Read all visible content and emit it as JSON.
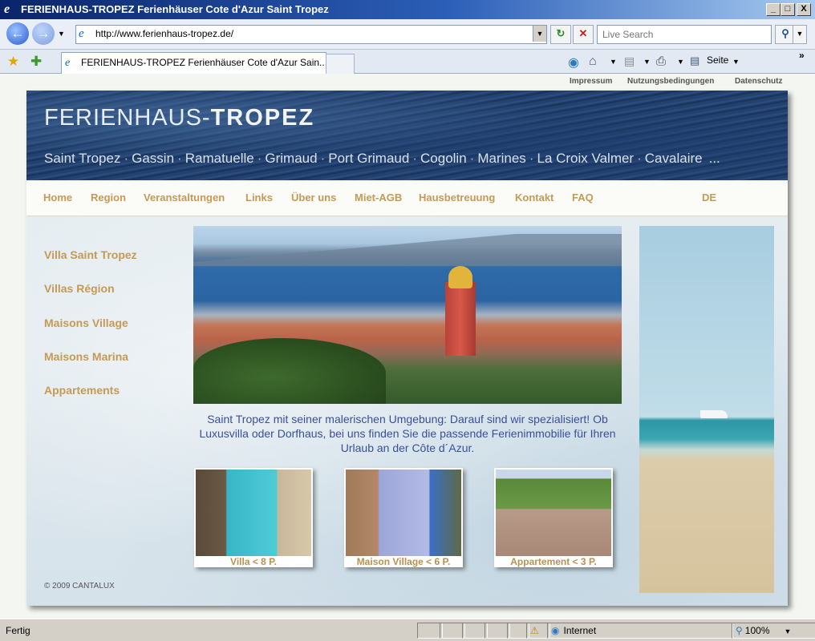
{
  "window": {
    "title": "FERIENHAUS-TROPEZ Ferienhäuser Cote d'Azur Saint Tropez",
    "minimize_label": "_",
    "maximize_label": "□",
    "close_label": "X"
  },
  "addressbar": {
    "url": "http://www.ferienhaus-tropez.de/",
    "search_placeholder": "Live Search"
  },
  "tabs": {
    "active_label": "FERIENHAUS-TROPEZ Ferienhäuser Cote d'Azur Sain..."
  },
  "commandbar": {
    "page_label": "Seite",
    "more_label": "»"
  },
  "site": {
    "toplinks": [
      "Impressum",
      "Nutzungsbedingungen",
      "Datenschutz"
    ],
    "brand_light": "FERIENHAUS-",
    "brand_bold": "TROPEZ",
    "places": [
      "Saint Tropez",
      "Gassin",
      "Ramatuelle",
      "Grimaud",
      "Port Grimaud",
      "Cogolin",
      "Marines",
      "La Croix Valmer",
      "Cavalaire",
      "..."
    ],
    "place_separator": "·",
    "nav": [
      "Home",
      "Region",
      "Veranstaltungen",
      "Links",
      "Über uns",
      "Miet-AGB",
      "Hausbetreuung",
      "Kontakt",
      "FAQ"
    ],
    "language": "DE",
    "sidenav": [
      "Villa Saint Tropez",
      "Villas Région",
      "Maisons Village",
      "Maisons Marina",
      "Appartements"
    ],
    "tagline": "Saint Tropez mit seiner malerischen Umgebung: Darauf sind wir spezialisiert! Ob Luxusvilla oder Dorfhaus, bei uns finden Sie die passende Ferienimmobilie für Ihren Urlaub an der Côte d´Azur.",
    "thumbs": [
      "Villa < 8 P.",
      "Maison Village < 6 P.",
      "Appartement < 3 P."
    ],
    "copyright": "© 2009 CANTALUX"
  },
  "statusbar": {
    "status": "Fertig",
    "zone": "Internet",
    "zoom": "100%"
  },
  "colors": {
    "nav_link": "#c49a55",
    "tagline": "#3a4f9a",
    "titlebar_start": "#0a246a"
  }
}
